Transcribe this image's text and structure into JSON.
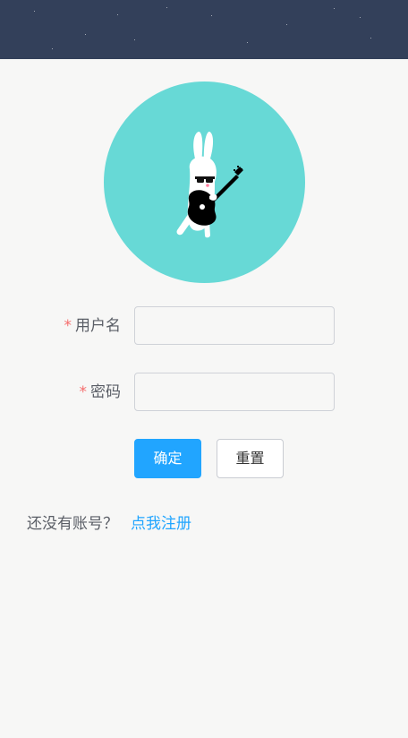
{
  "header": {
    "background": "#33405a"
  },
  "avatar": {
    "icon": "rabbit-guitar-icon",
    "background": "#67d9d6"
  },
  "form": {
    "username": {
      "required_mark": "*",
      "label": "用户名",
      "value": ""
    },
    "password": {
      "required_mark": "*",
      "label": "密码",
      "value": ""
    }
  },
  "buttons": {
    "confirm_label": "确定",
    "reset_label": "重置",
    "primary_color": "#21a5ff"
  },
  "register": {
    "prompt": "还没有账号？",
    "link_text": "点我注册"
  }
}
